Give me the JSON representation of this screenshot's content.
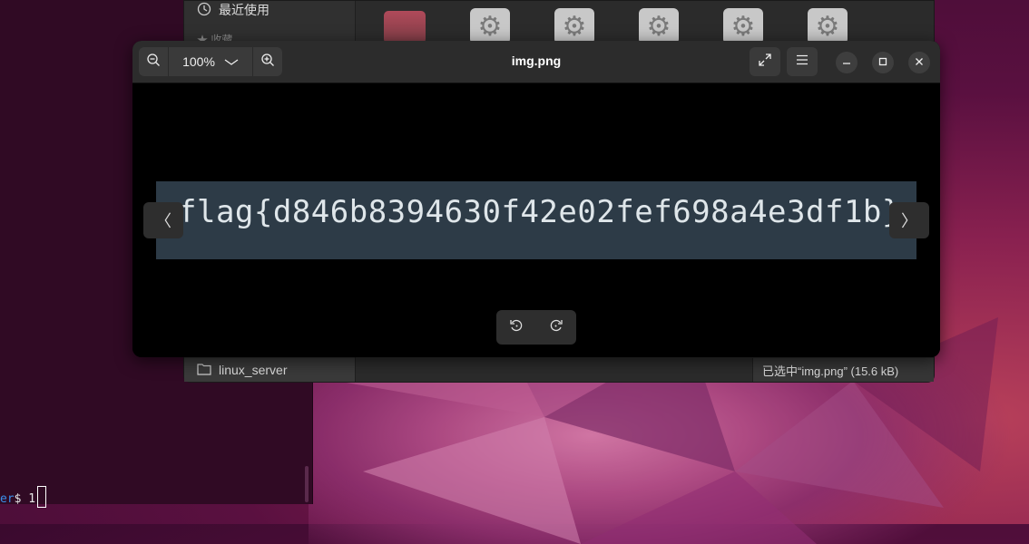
{
  "terminal": {
    "user_suffix": "er",
    "prompt_tail": "$ 1"
  },
  "file_manager": {
    "sidebar_recent": "最近使用",
    "sidebar_favorites": "★ 收藏",
    "linux_server": "linux_server",
    "status": "已选中“img.png” (15.6 kB)"
  },
  "viewer": {
    "title": "img.png",
    "zoom": "100%",
    "image_text": "flag{d846b8394630f42e02fef698a4e3df1b}",
    "prev_glyph": "〈",
    "next_glyph": "〉"
  },
  "icons": [
    "zoom-out-icon",
    "chevron-down-icon",
    "zoom-in-icon",
    "fullscreen-icon",
    "hamburger-menu-icon",
    "minimize-icon",
    "maximize-icon",
    "close-icon",
    "rotate-left-icon",
    "rotate-right-icon",
    "clock-icon",
    "folder-icon",
    "gear-icon"
  ],
  "colors": {
    "viewer_bg": "#000000",
    "headerbar": "#2c2c2c",
    "image_bg": "#2d3b47",
    "terminal_bg": "#300a24"
  }
}
